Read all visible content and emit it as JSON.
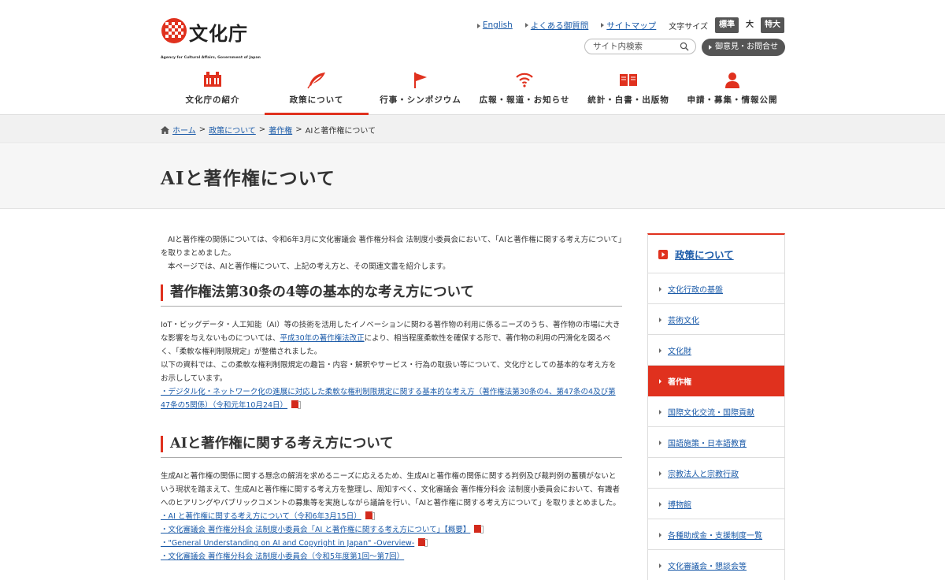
{
  "header": {
    "logo_ja": "文化庁",
    "logo_en": "Agency for Cultural Affairs, Government of Japan",
    "util_links": [
      "English",
      "よくある御質問",
      "サイトマップ"
    ],
    "font_size_label": "文字サイズ",
    "font_sizes": [
      "標準",
      "大",
      "特大"
    ],
    "search_placeholder": "サイト内検索",
    "contact_label": "御意見・お問合せ"
  },
  "nav": {
    "items": [
      "文化庁の紹介",
      "政策について",
      "行事・シンポジウム",
      "広報・報道・お知らせ",
      "統計・白書・出版物",
      "申請・募集・情報公開"
    ],
    "active_index": 1
  },
  "breadcrumb": {
    "items": [
      "ホーム",
      "政策について",
      "著作権"
    ],
    "current": "AIと著作権について"
  },
  "page": {
    "title": "AIと著作権について",
    "intro": [
      "AIと著作権の関係については、令和6年3月に文化審議会 著作権分科会 法制度小委員会において、「AIと著作権に関する考え方について」を取りまとめました。",
      "本ページでは、AIと著作権について、上記の考え方と、その関連文書を紹介します。"
    ]
  },
  "section1": {
    "heading": "著作権法第30条の4等の基本的な考え方について",
    "p1_before": "IoT・ビッグデータ・人工知能（AI）等の技術を活用したイノベーションに関わる著作物の利用に係るニーズのうち、著作物の市場に大きな影響を与えないものについては、",
    "p1_link": "平成30年の著作権法改正",
    "p1_after": "により、相当程度柔軟性を確保する形で、著作物の利用の円滑化を図るべく、「柔軟な権利制限規定」が整備されました。",
    "p2": "以下の資料では、この柔軟な権利制限規定の趣旨・内容・解釈やサービス・行為の取扱い等について、文化庁としての基本的な考え方をお示ししています。",
    "doc_link": "・デジタル化・ネットワーク化の進展に対応した柔軟な権利制限規定に関する基本的な考え方（著作権法第30条の4、第47条の4及び第47条の5関係）（令和元年10月24日）"
  },
  "section2": {
    "heading": "AIと著作権に関する考え方について",
    "p1": "生成AIと著作権の関係に関する懸念の解消を求めるニーズに応えるため、生成AIと著作権の関係に関する判例及び裁判例の蓄積がないという現状を踏まえて、生成AIと著作権に関する考え方を整理し、周知すべく、文化審議会 著作権分科会 法制度小委員会において、有識者へのヒアリングやパブリックコメントの募集等を実施しながら議論を行い、「AIと著作権に関する考え方について」を取りまとめました。",
    "links": [
      "・AI と著作権に関する考え方について（令和6年3月15日）",
      "・文化審議会 著作権分科会 法制度小委員会「AI と著作権に関する考え方について」【概要】",
      "・\"General Understanding on AI and Copyright in Japan\" -Overview-",
      "・文化審議会 著作権分科会 法制度小委員会（令和5年度第1回〜第7回）"
    ]
  },
  "sidebar": {
    "heading": "政策について",
    "items": [
      "文化行政の基盤",
      "芸術文化",
      "文化財",
      "著作権",
      "国際文化交流・国際貢献",
      "国語施策・日本語教育",
      "宗教法人と宗教行政",
      "博物館",
      "各種助成金・支援制度一覧",
      "文化審議会・懇談会等"
    ],
    "active_index": 3
  },
  "colors": {
    "accent": "#e0311e",
    "link": "#1a5aa8",
    "pdf_icon": "#d32a1c"
  }
}
